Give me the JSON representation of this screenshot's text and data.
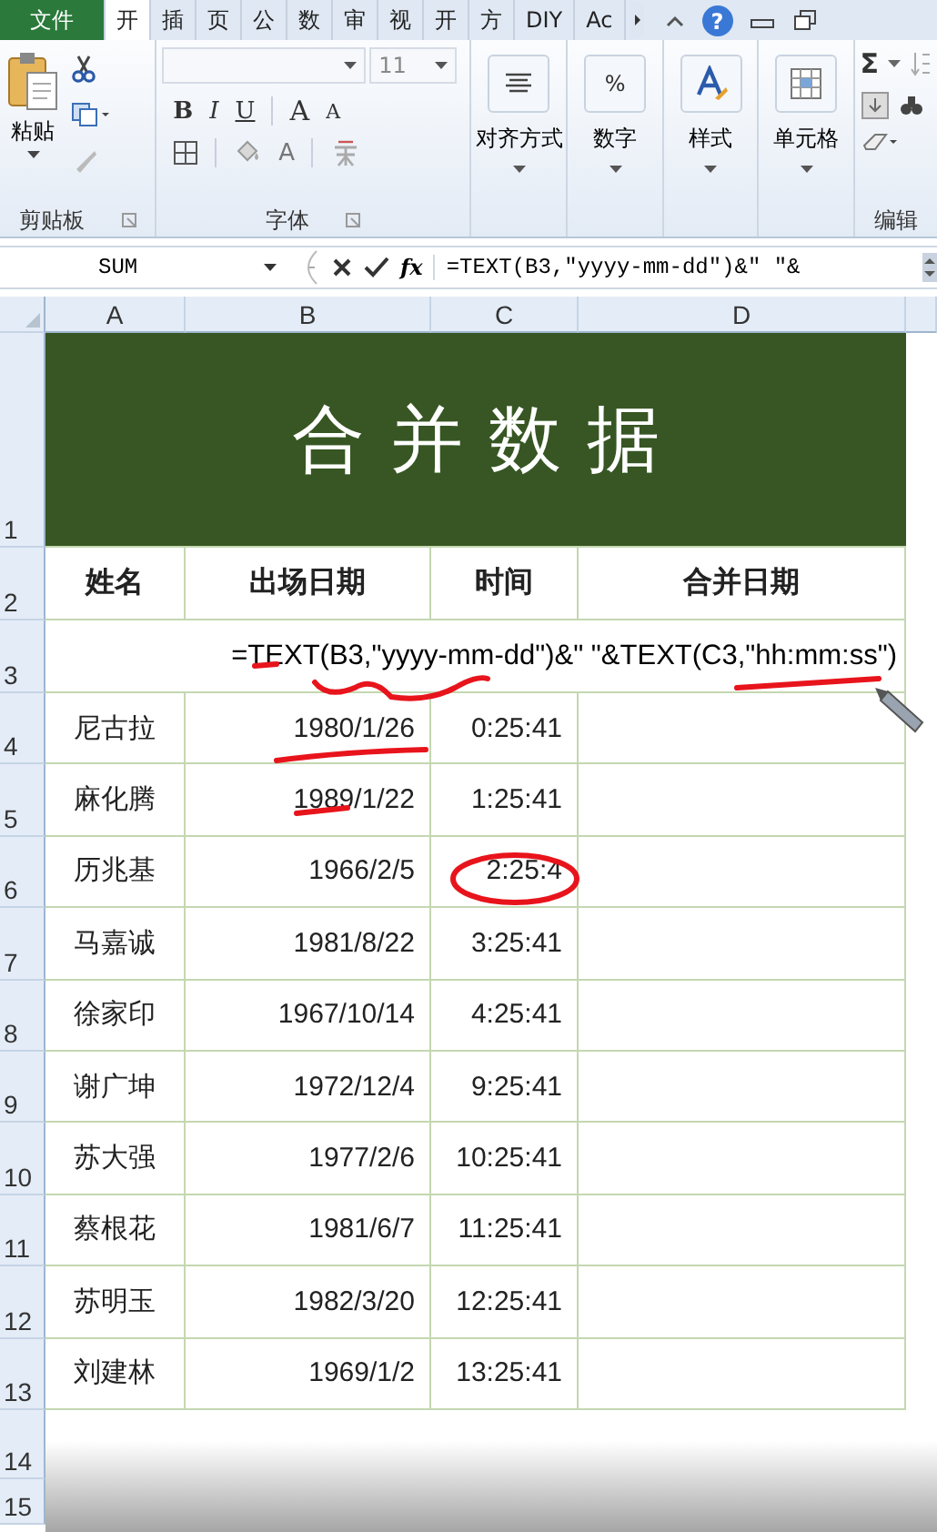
{
  "ribbon_tabs": [
    {
      "label": "文件",
      "kind": "file",
      "selected": false
    },
    {
      "label": "开",
      "kind": "tab",
      "selected": true
    },
    {
      "label": "插",
      "kind": "tab",
      "selected": false
    },
    {
      "label": "页",
      "kind": "tab",
      "selected": false
    },
    {
      "label": "公",
      "kind": "tab",
      "selected": false
    },
    {
      "label": "数",
      "kind": "tab",
      "selected": false
    },
    {
      "label": "审",
      "kind": "tab",
      "selected": false
    },
    {
      "label": "视",
      "kind": "tab",
      "selected": false
    },
    {
      "label": "开",
      "kind": "tab",
      "selected": false
    },
    {
      "label": "方",
      "kind": "tab",
      "selected": false
    },
    {
      "label": "DIY",
      "kind": "tab",
      "selected": false
    },
    {
      "label": "Ac",
      "kind": "tab",
      "selected": false
    }
  ],
  "help": "?",
  "ribbon": {
    "clipboard": {
      "title": "剪贴板",
      "paste": "粘贴"
    },
    "font": {
      "title": "字体",
      "size": "11",
      "style_buttons": [
        {
          "label": "B",
          "kind": "bold"
        },
        {
          "label": "I",
          "kind": "italic"
        },
        {
          "label": "U",
          "kind": "underline"
        }
      ],
      "grow": "A",
      "shrink": "A",
      "color_letter": "A"
    },
    "big_buttons": [
      {
        "label": "对齐方式",
        "kind": "align"
      },
      {
        "label": "数字",
        "kind": "number",
        "glyph": "%"
      },
      {
        "label": "样式",
        "kind": "style"
      },
      {
        "label": "单元格",
        "kind": "cells"
      }
    ],
    "editing": {
      "title": "编辑",
      "sum": "Σ"
    }
  },
  "formula_bar": {
    "name_box": "SUM",
    "fx": "fx",
    "formula": "=TEXT(B3,″yyyy-mm-dd″)&″ ″&"
  },
  "columns": [
    "A",
    "B",
    "C",
    "D"
  ],
  "title_row": {
    "number": "1",
    "text": "合并数据"
  },
  "header_row": {
    "number": "2",
    "cells": [
      "姓名",
      "出场日期",
      "时间",
      "合并日期"
    ]
  },
  "editing_row": {
    "number": "3",
    "text": "=TEXT(B3,\"yyyy-mm-dd\")&\" \"&TEXT(C3,\"hh:mm:ss\")"
  },
  "rows": [
    {
      "number": "4",
      "name": "尼古拉",
      "date": "1980/1/26",
      "time": "0:25:41"
    },
    {
      "number": "5",
      "name": "麻化腾",
      "date": "1989/1/22",
      "time": "1:25:41"
    },
    {
      "number": "6",
      "name": "历兆基",
      "date": "1966/2/5",
      "time": "2:25:4"
    },
    {
      "number": "7",
      "name": "马嘉诚",
      "date": "1981/8/22",
      "time": "3:25:41"
    },
    {
      "number": "8",
      "name": "徐家印",
      "date": "1967/10/14",
      "time": "4:25:41"
    },
    {
      "number": "9",
      "name": "谢广坤",
      "date": "1972/12/4",
      "time": "9:25:41"
    },
    {
      "number": "10",
      "name": "苏大强",
      "date": "1977/2/6",
      "time": "10:25:41"
    },
    {
      "number": "11",
      "name": "蔡根花",
      "date": "1981/6/7",
      "time": "11:25:41"
    },
    {
      "number": "12",
      "name": "苏明玉",
      "date": "1982/3/20",
      "time": "12:25:41"
    },
    {
      "number": "13",
      "name": "刘建林",
      "date": "1969/1/2",
      "time": "13:25:41"
    }
  ],
  "empty_rows": [
    "14",
    "15"
  ]
}
